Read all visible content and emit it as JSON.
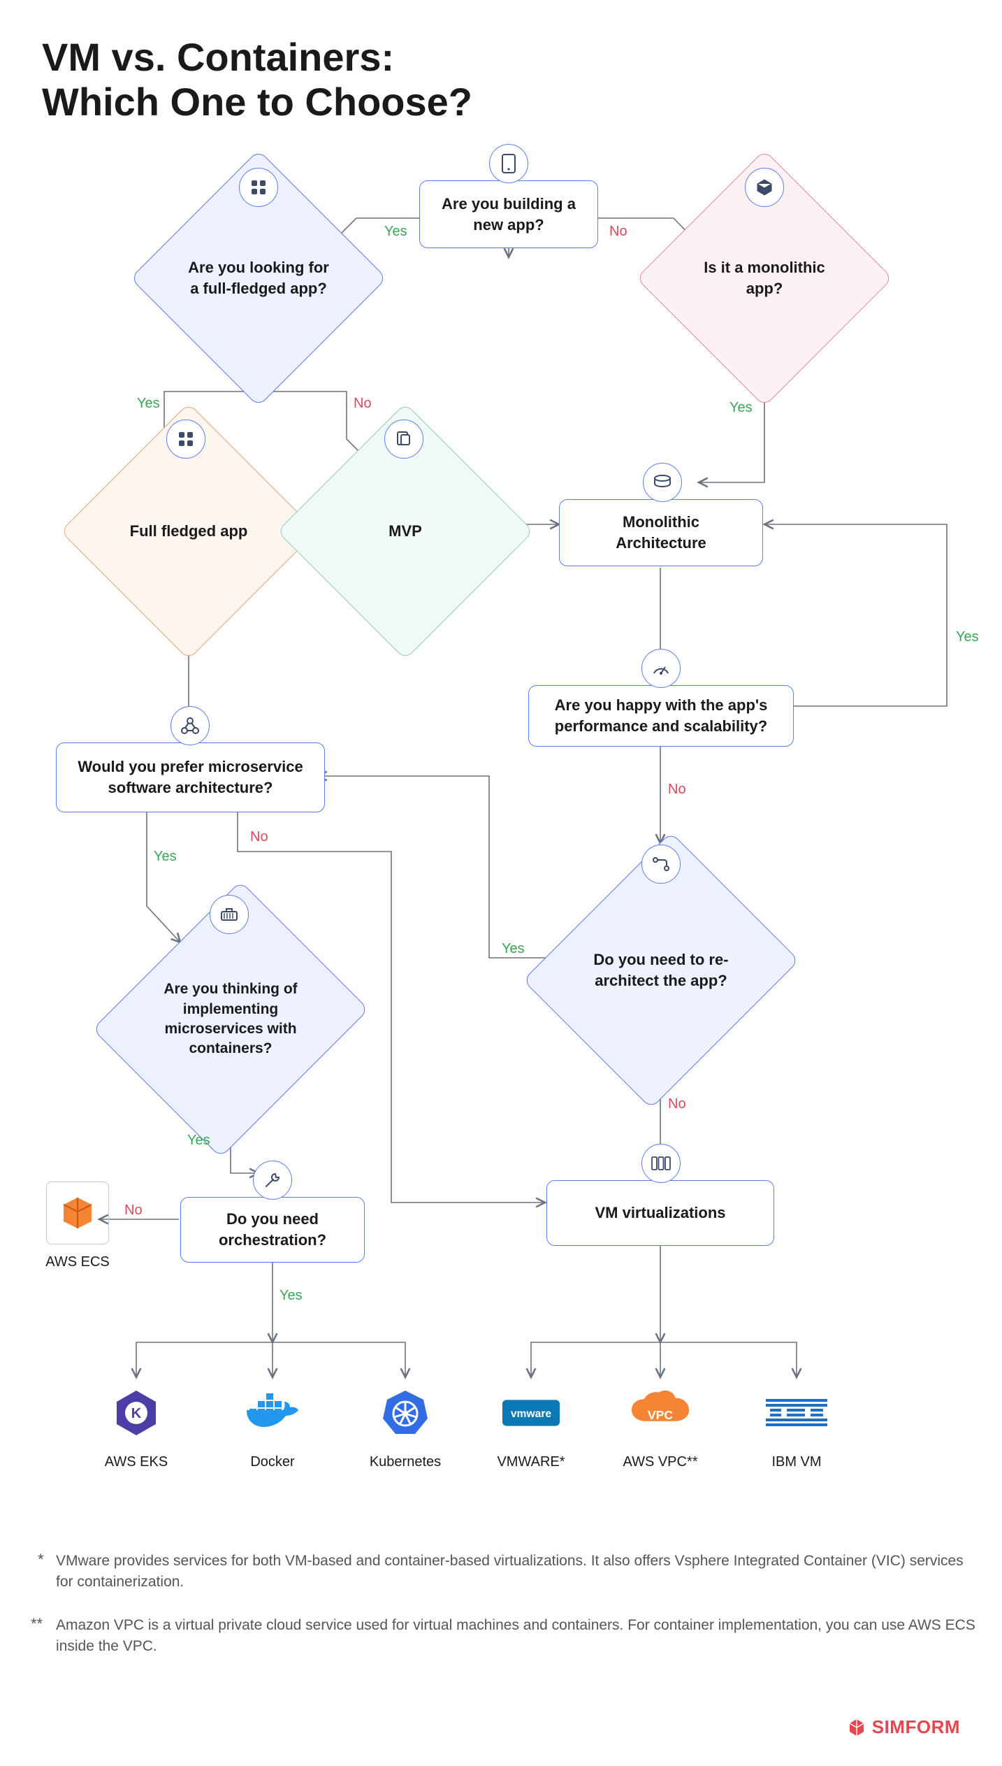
{
  "title": "VM vs. Containers:\nWhich One to Choose?",
  "nodes": {
    "building": "Are you building a new app?",
    "fullfledged_q": "Are you looking for a full-fledged app?",
    "monolithic_q": "Is it a monolithic app?",
    "fullfledged": "Full fledged app",
    "mvp": "MVP",
    "monoarch": "Monolithic Architecture",
    "microservice_q": "Would you prefer microservice software architecture?",
    "perf_q": "Are you happy with the app's performance and scalability?",
    "containers_q": "Are you thinking of implementing microservices with containers?",
    "rearch_q": "Do you need to re-architect the app?",
    "orchestration_q": "Do you need orchestration?",
    "vmvirt": "VM virtualizations"
  },
  "labels": {
    "yes": "Yes",
    "no": "No"
  },
  "logos": {
    "aws_ecs": "AWS ECS",
    "aws_eks": "AWS EKS",
    "docker": "Docker",
    "k8s": "Kubernetes",
    "vmware": "VMWARE*",
    "aws_vpc": "AWS VPC**",
    "ibm_vm": "IBM VM"
  },
  "footnotes": {
    "f1": "VMware provides services for both VM-based and container-based virtualizations. It also offers Vsphere Integrated Container (VIC) services for containerization.",
    "f2": "Amazon VPC is a virtual private cloud service used for virtual machines and containers. For container implementation, you can use AWS ECS inside the VPC."
  },
  "brand": "SIMFORM",
  "colors": {
    "arrow": "#6b7280",
    "yes": "#3aa655",
    "no": "#d64a5b"
  }
}
